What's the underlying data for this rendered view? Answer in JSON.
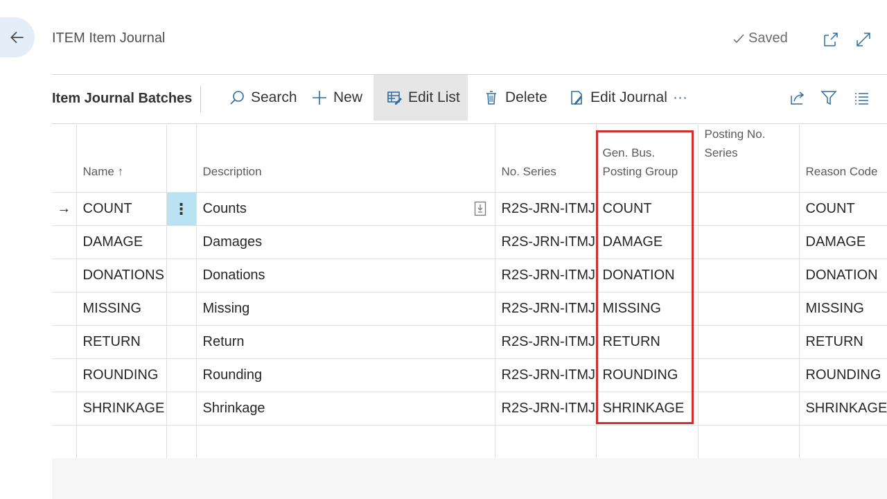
{
  "page": {
    "title": "ITEM Item Journal",
    "status": "Saved"
  },
  "actionbar": {
    "title": "Item Journal Batches",
    "search": "Search",
    "new": "New",
    "edit_list": "Edit List",
    "delete": "Delete",
    "edit_journal": "Edit Journal",
    "more": "···"
  },
  "columns": {
    "name": "Name ↑",
    "description": "Description",
    "no_series": "No. Series",
    "gen_bus_line1": "Gen. Bus.",
    "gen_bus_line2": "Posting Group",
    "posting_no_line1": "Posting No.",
    "posting_no_line2": "Series",
    "reason_code": "Reason Code"
  },
  "rows": [
    {
      "name": "COUNT",
      "description": "Counts",
      "no_series": "R2S-JRN-ITMJ",
      "gen_bus": "COUNT",
      "posting_no": "",
      "reason": "COUNT"
    },
    {
      "name": "DAMAGE",
      "description": "Damages",
      "no_series": "R2S-JRN-ITMJ",
      "gen_bus": "DAMAGE",
      "posting_no": "",
      "reason": "DAMAGE"
    },
    {
      "name": "DONATIONS",
      "description": "Donations",
      "no_series": "R2S-JRN-ITMJ",
      "gen_bus": "DONATION",
      "posting_no": "",
      "reason": "DONATION"
    },
    {
      "name": "MISSING",
      "description": "Missing",
      "no_series": "R2S-JRN-ITMJ",
      "gen_bus": "MISSING",
      "posting_no": "",
      "reason": "MISSING"
    },
    {
      "name": "RETURN",
      "description": "Return",
      "no_series": "R2S-JRN-ITMJ",
      "gen_bus": "RETURN",
      "posting_no": "",
      "reason": "RETURN"
    },
    {
      "name": "ROUNDING",
      "description": "Rounding",
      "no_series": "R2S-JRN-ITMJ",
      "gen_bus": "ROUNDING",
      "posting_no": "",
      "reason": "ROUNDING"
    },
    {
      "name": "SHRINKAGE",
      "description": "Shrinkage",
      "no_series": "R2S-JRN-ITMJ",
      "gen_bus": "SHRINKAGE",
      "posting_no": "",
      "reason": "SHRINKAGE"
    }
  ],
  "selection": {
    "row_marker": "→",
    "row_menu": "⋮"
  },
  "colors": {
    "accent": "#0078d4",
    "highlight_border": "#d32f2f",
    "selected_cell": "#b9e3f3"
  }
}
